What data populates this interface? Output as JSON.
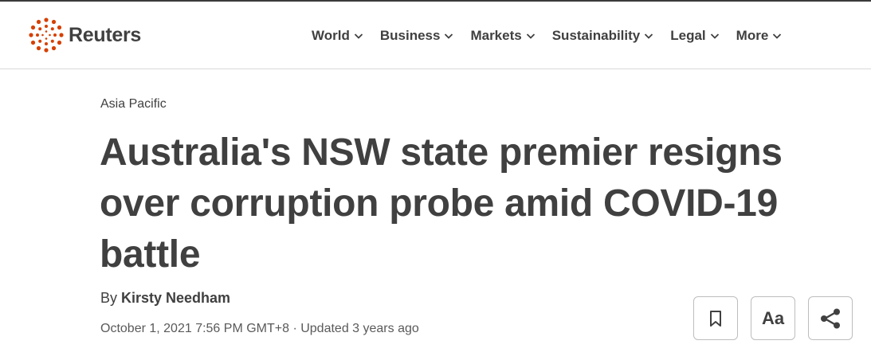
{
  "brand": {
    "name": "Reuters",
    "accent_color": "#d64000"
  },
  "nav": {
    "items": [
      {
        "label": "World",
        "icon": "chevron-down-icon"
      },
      {
        "label": "Business",
        "icon": "chevron-down-icon"
      },
      {
        "label": "Markets",
        "icon": "chevron-down-icon"
      },
      {
        "label": "Sustainability",
        "icon": "chevron-down-icon"
      },
      {
        "label": "Legal",
        "icon": "chevron-down-icon"
      },
      {
        "label": "More",
        "icon": "chevron-down-icon"
      }
    ]
  },
  "article": {
    "section": "Asia Pacific",
    "headline": "Australia's NSW state premier resigns over corruption probe amid COVID-19 battle",
    "byline_prefix": "By ",
    "author": "Kirsty Needham",
    "dateline": "October 1, 2021 7:56 PM GMT+8 · Updated 3 years ago"
  },
  "actions": {
    "bookmark_icon": "bookmark-icon",
    "text_size_label": "Aa",
    "share_icon": "share-icon"
  }
}
